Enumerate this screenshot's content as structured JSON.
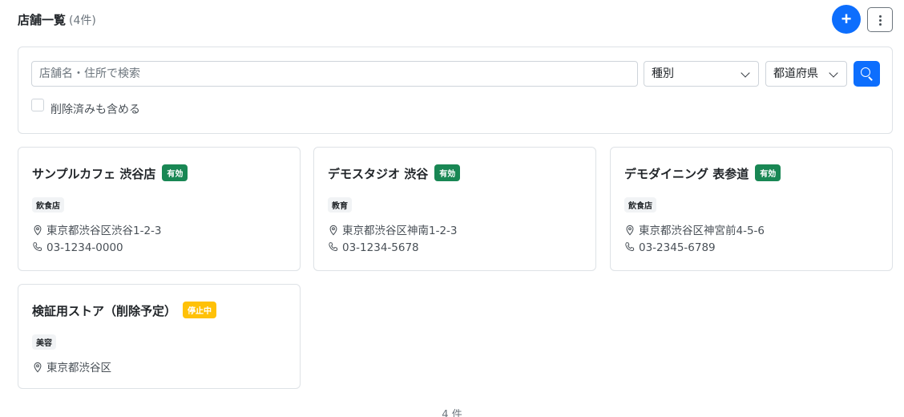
{
  "header": {
    "title": "店舗一覧",
    "count": "(4件)",
    "add_label": "+"
  },
  "search": {
    "placeholder": "店舗名・住所で検索",
    "kind_select": "種別",
    "pref_select": "都道府県",
    "include_deleted_label": "削除済みも含める",
    "include_deleted_checked": false
  },
  "stores": [
    {
      "name": "サンプルカフェ 渋谷店",
      "status": "有効",
      "status_color": "#198754",
      "type": "飲食店",
      "address": "東京都渋谷区渋谷1-2-3",
      "phone": "03-1234-0000"
    },
    {
      "name": "デモスタジオ 渋谷",
      "status": "有効",
      "status_color": "#198754",
      "type": "教育",
      "address": "東京都渋谷区神南1-2-3",
      "phone": "03-1234-5678"
    },
    {
      "name": "デモダイニング 表参道",
      "status": "有効",
      "status_color": "#198754",
      "type": "飲食店",
      "address": "東京都渋谷区神宮前4-5-6",
      "phone": "03-2345-6789"
    },
    {
      "name": "検証用ストア（削除予定）",
      "status": "停止中",
      "status_color": "#ffc107",
      "type": "美容",
      "address": "東京都渋谷区",
      "phone": ""
    }
  ],
  "footer": {
    "count": "4 件"
  },
  "icons": {
    "add": "plus-icon",
    "more": "kebab-menu-icon",
    "search": "search-icon",
    "address": "map-pin-icon",
    "phone": "phone-icon",
    "dropdown": "chevron-down-icon"
  },
  "colors": {
    "primary": "#0d6efd",
    "active": "#198754",
    "stopped": "#ffc107"
  }
}
